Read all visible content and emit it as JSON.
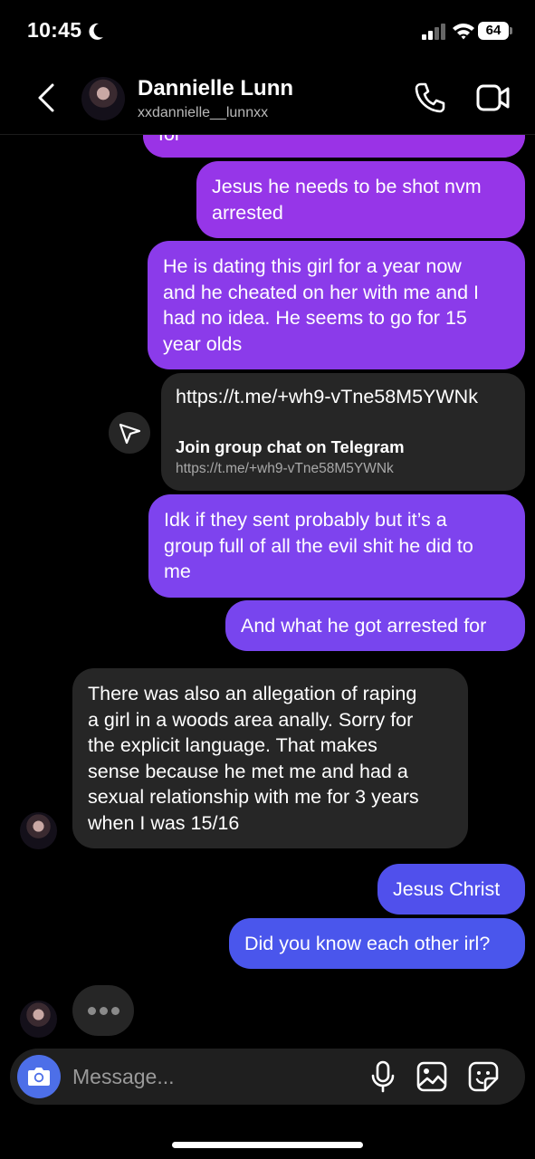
{
  "status_bar": {
    "time": "10:45",
    "battery": "64",
    "icons": [
      "moon-icon",
      "signal-icon",
      "wifi-icon",
      "battery-icon"
    ]
  },
  "header": {
    "name": "Dannielle Lunn",
    "username": "xxdannielle__lunnxx",
    "icons": [
      "back-chevron-icon",
      "phone-icon",
      "video-camera-icon"
    ]
  },
  "messages": {
    "top_partial": "for",
    "m1": {
      "line1": "Jesus he needs to be shot nvm",
      "line2": "arrested"
    },
    "m2": {
      "line1": "He is dating this girl for a year now",
      "line2": "and he cheated on her with me and I",
      "line3": "had no idea. He seems to go for 15",
      "line4": "year olds"
    },
    "link": {
      "url_text": "https://t.me/+wh9-vTne58M5YWNk",
      "preview_title": "Join group chat on Telegram",
      "preview_url": "https://t.me/+wh9-vTne58M5YWNk"
    },
    "m3": {
      "line1": "Idk if they sent probably but it’s a",
      "line2": "group full of all the evil shit he did to",
      "line3": "me"
    },
    "m4": "And what he got arrested for",
    "r1": {
      "line1": "There was also an allegation of raping",
      "line2": "a girl in a woods area anally. Sorry for",
      "line3": "the explicit language. That makes",
      "line4": "sense because he met me and had a",
      "line5": "sexual relationship with me for 3 years",
      "line6": "when I was 15/16"
    },
    "m5": "Jesus Christ",
    "m6": "Did you know each other irl?"
  },
  "composer": {
    "placeholder": "Message...",
    "icons": [
      "camera-icon",
      "microphone-icon",
      "gallery-icon",
      "sticker-icon"
    ]
  },
  "colors": {
    "bubble_purple": "#9536e8",
    "bubble_violet": "#7a45ee",
    "bubble_blue": "#4a56ec",
    "received_bubble": "#262626",
    "accent_blue": "#4d6fe8"
  }
}
